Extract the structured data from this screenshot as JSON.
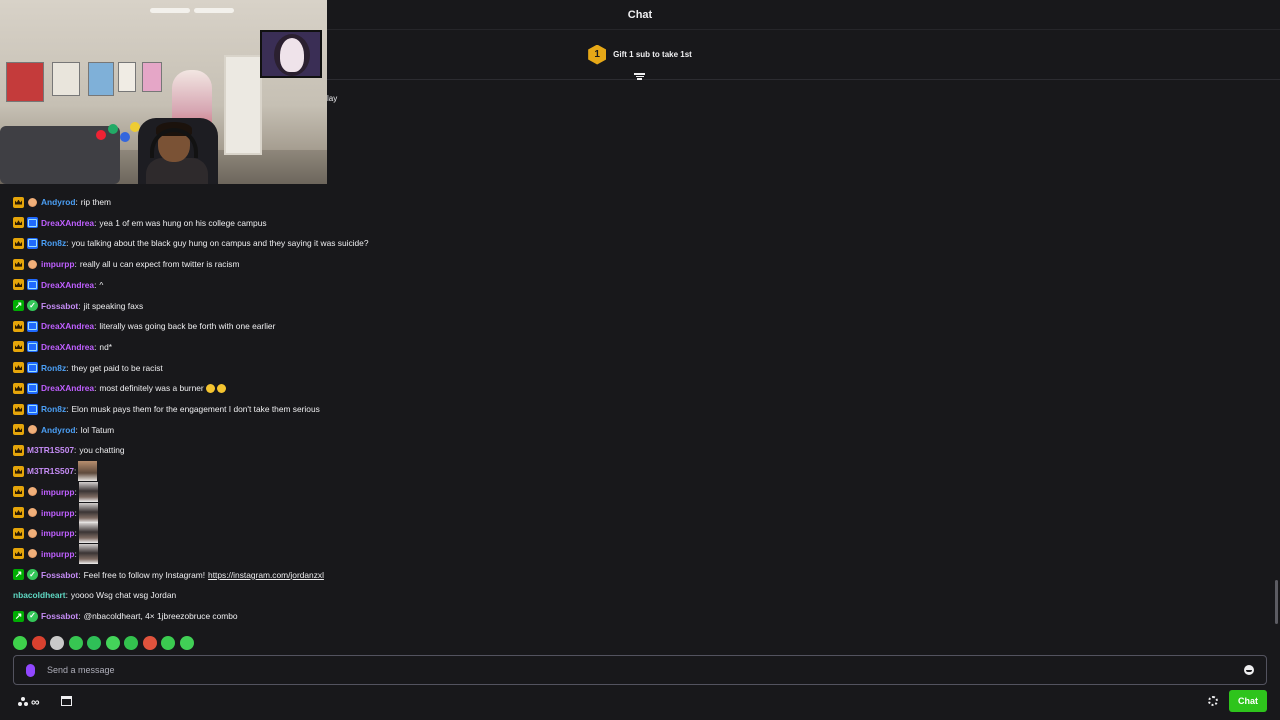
{
  "header": {
    "title": "Chat"
  },
  "leaderboard": {
    "rank": "1",
    "text": "Gift 1 sub to take 1st"
  },
  "partial_overlay_text": "lay",
  "colors": {
    "purple": "#bf5fff",
    "blue": "#4b9ff5",
    "violet": "#c58cf5",
    "teal": "#5fd9c4",
    "accent": "#9147ff",
    "chat_button": "#2ec41c"
  },
  "messages": [
    {
      "user": "Andyrod",
      "color": "blue",
      "badges": [
        "crown-icon",
        "face-badge-icon"
      ],
      "text": "rip them"
    },
    {
      "user": "DreaXAndrea",
      "color": "purple",
      "badges": [
        "crown-icon",
        "game-badge-icon"
      ],
      "text": "yea 1 of em was hung on his college campus"
    },
    {
      "user": "Ron8z",
      "color": "blue",
      "badges": [
        "crown-icon",
        "game-badge-icon"
      ],
      "text": "you talking about the black guy hung on campus and they saying it was suicide?"
    },
    {
      "user": "impurpp",
      "color": "purple",
      "badges": [
        "crown-icon",
        "face-badge-icon"
      ],
      "text": "really all u can expect from twitter is racism"
    },
    {
      "user": "DreaXAndrea",
      "color": "purple",
      "badges": [
        "crown-icon",
        "game-badge-icon"
      ],
      "text": "^"
    },
    {
      "user": "Fossabot",
      "color": "violet",
      "badges": [
        "mod-icon",
        "verified-bot-icon"
      ],
      "text": "jit speaking faxs"
    },
    {
      "user": "DreaXAndrea",
      "color": "purple",
      "badges": [
        "crown-icon",
        "game-badge-icon"
      ],
      "text": "literally was going back be forth with one earlier"
    },
    {
      "user": "DreaXAndrea",
      "color": "purple",
      "badges": [
        "crown-icon",
        "game-badge-icon"
      ],
      "text": "nd*"
    },
    {
      "user": "Ron8z",
      "color": "blue",
      "badges": [
        "crown-icon",
        "game-badge-icon"
      ],
      "text": "they get paid to be racist"
    },
    {
      "user": "DreaXAndrea",
      "color": "purple",
      "badges": [
        "crown-icon",
        "game-badge-icon"
      ],
      "text": "most definitely was a burner",
      "emojis": 2
    },
    {
      "user": "Ron8z",
      "color": "blue",
      "badges": [
        "crown-icon",
        "game-badge-icon"
      ],
      "text": "Elon musk pays them for the engagement I don't take them serious"
    },
    {
      "user": "Andyrod",
      "color": "blue",
      "badges": [
        "crown-icon",
        "face-badge-icon"
      ],
      "text": "lol Tatum"
    },
    {
      "user": "M3TR1S507",
      "color": "violet",
      "badges": [
        "crown-icon"
      ],
      "text": "you chatting"
    },
    {
      "user": "M3TR1S507",
      "color": "violet",
      "badges": [
        "crown-icon"
      ],
      "text": "",
      "emote": "face-emote-icon"
    },
    {
      "user": "impurpp",
      "color": "purple",
      "badges": [
        "crown-icon",
        "face-badge-icon"
      ],
      "text": "",
      "emote": "dark-face-emote-icon"
    },
    {
      "user": "impurpp",
      "color": "purple",
      "badges": [
        "crown-icon",
        "face-badge-icon"
      ],
      "text": "",
      "emote": "dark-face-emote-icon"
    },
    {
      "user": "impurpp",
      "color": "purple",
      "badges": [
        "crown-icon",
        "face-badge-icon"
      ],
      "text": "",
      "emote": "dark-face-emote-icon"
    },
    {
      "user": "impurpp",
      "color": "purple",
      "badges": [
        "crown-icon",
        "face-badge-icon"
      ],
      "text": "",
      "emote": "dark-face-emote-icon"
    },
    {
      "user": "Fossabot",
      "color": "violet",
      "badges": [
        "mod-icon",
        "verified-bot-icon"
      ],
      "text": "Feel free to follow my Instagram!",
      "link": "https://instagram.com/jordanzxl"
    },
    {
      "user": "nbacoldheart",
      "color": "teal",
      "badges": [],
      "text": "yoooo Wsg chat wsg Jordan"
    },
    {
      "user": "Fossabot",
      "color": "violet",
      "badges": [
        "mod-icon",
        "verified-bot-icon"
      ],
      "text": "@nbacoldheart, 4× 1jbreezobruce combo"
    }
  ],
  "emote_bar": [
    {
      "icon": "green-face-emote-icon",
      "color": "#3ed14b"
    },
    {
      "icon": "red-face-emote-icon",
      "color": "#d9412f"
    },
    {
      "icon": "clown-emote-icon",
      "color": "#c9c9c9"
    },
    {
      "icon": "green-grin-emote-icon",
      "color": "#37c652"
    },
    {
      "icon": "green-shades-emote-icon",
      "color": "#2fbf57"
    },
    {
      "icon": "green-smile-emote-icon",
      "color": "#44d45a"
    },
    {
      "icon": "green-wink-emote-icon",
      "color": "#33c24e"
    },
    {
      "icon": "red-lips-emote-icon",
      "color": "#e0533d"
    },
    {
      "icon": "green-laugh-emote-icon",
      "color": "#3bcb50"
    },
    {
      "icon": "green-tongue-emote-icon",
      "color": "#41cf56"
    }
  ],
  "input": {
    "placeholder": "Send a message"
  },
  "bottom": {
    "points_value": "∞",
    "chat_button": "Chat"
  }
}
